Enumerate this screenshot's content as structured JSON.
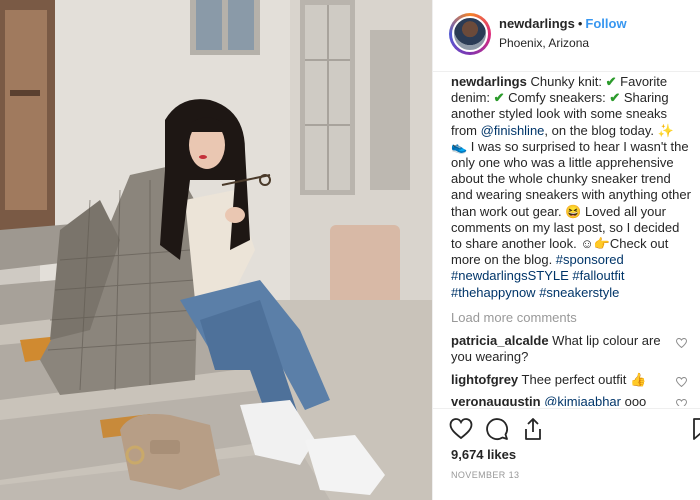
{
  "post": {
    "username": "newdarlings",
    "follow_label": "Follow",
    "separator": "•",
    "location": "Phoenix, Arizona"
  },
  "caption": {
    "author": "newdarlings",
    "part1": " Chunky knit: ",
    "check": "✔",
    "part2": " Favorite denim: ",
    "part3": " Comfy sneakers: ",
    "part4": "  Sharing another styled look with some sneaks from ",
    "mention": "@finishline",
    "part5": ", on the blog today. ",
    "sparkle_emoji": "✨",
    "shoe_emoji": "👟",
    "part6": " I was so surprised to hear I wasn't the only one who was a little apprehensive about the whole chunky sneaker trend and wearing sneakers with anything other than work out gear. ",
    "grin_emoji": "😆",
    "part7": " Loved all your comments on my last post, so I decided to share another look. ",
    "point_emoji": "☺👉",
    "part8": "Check out more on the blog. ",
    "tags": [
      "#sponsored",
      "#newdarlingsSTYLE",
      "#falloutfit",
      "#thehappynow",
      "#sneakerstyle"
    ]
  },
  "load_more": "Load more comments",
  "comments": [
    {
      "user": "patricia_alcalde",
      "text": " What lip colour are you wearing?"
    },
    {
      "user": "lightofgrey",
      "text": " Thee perfect outfit 👍"
    },
    {
      "user": "veronaugustin",
      "mention": "@kimiaabhar",
      "text": " ooo yes!"
    }
  ],
  "likes": "9,674 likes",
  "date": "NOVEMBER 13",
  "icons": [
    "heart-icon",
    "comment-icon",
    "share-icon",
    "bookmark-icon"
  ],
  "colors": {
    "accent": "#3897f0",
    "link": "#003569",
    "muted": "#999999"
  }
}
